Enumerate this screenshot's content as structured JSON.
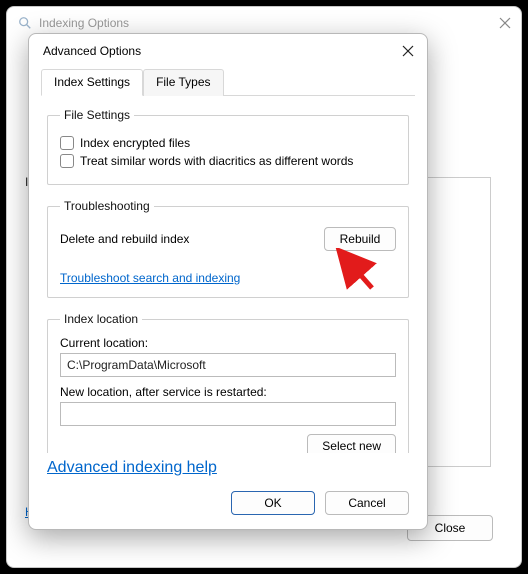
{
  "bg_window": {
    "title": "Indexing Options",
    "truncated_i": "I",
    "truncated_h": "H",
    "close_label": "Close"
  },
  "dialog": {
    "title": "Advanced Options",
    "tabs": {
      "settings": "Index Settings",
      "filetypes": "File Types"
    },
    "file_settings": {
      "legend": "File Settings",
      "encrypted": "Index encrypted files",
      "diacritics": "Treat similar words with diacritics as different words"
    },
    "troubleshooting": {
      "legend": "Troubleshooting",
      "delete_label": "Delete and rebuild index",
      "rebuild_button": "Rebuild",
      "troubleshoot_link": "Troubleshoot search and indexing"
    },
    "index_location": {
      "legend": "Index location",
      "current_label": "Current location:",
      "current_value": "C:\\ProgramData\\Microsoft",
      "new_label": "New location, after service is restarted:",
      "new_value": "",
      "select_new_button": "Select new"
    },
    "help_link": "Advanced indexing help",
    "buttons": {
      "ok": "OK",
      "cancel": "Cancel"
    }
  }
}
